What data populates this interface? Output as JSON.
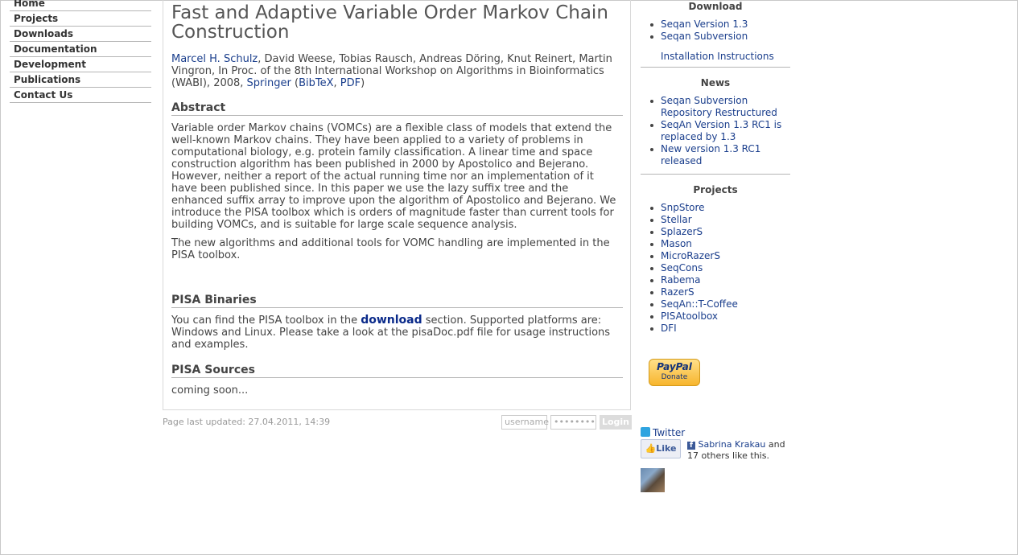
{
  "nav": {
    "items": [
      "Home",
      "Projects",
      "Downloads",
      "Documentation",
      "Development",
      "Publications",
      "Contact Us"
    ]
  },
  "article": {
    "title": "Fast and Adaptive Variable Order Markov Chain Construction",
    "author_link": "Marcel H. Schulz",
    "authors_rest": ", David Weese, Tobias Rausch, Andreas Döring, Knut Reinert, Martin Vingron, In Proc. of the 8th International Workshop on Algorithms in Bioinformatics (WABI), 2008, ",
    "springer_link": "Springer",
    "bibtex_link": "BibTeX",
    "pdf_link": "PDF",
    "abstract_heading": "Abstract",
    "abstract_p1": "Variable order Markov chains (VOMCs) are a flexible class of models that extend the well-known Markov chains. They have been applied to a variety of problems in computational biology, e.g. protein family classification. A linear time and space construction algorithm has been published in 2000 by Apostolico and Bejerano. However, neither a report of the actual running time nor an implementation of it have been published since. In this paper we use the lazy suffix tree and the enhanced suffix array to improve upon the algorithm of Apostolico and Bejerano. We introduce the PISA toolbox which is orders of magnitude faster than current tools for building VOMCs, and is suitable for large scale sequence analysis.",
    "abstract_p2": "The new algorithms and additional tools for VOMC handling are implemented in the PISA toolbox.",
    "binaries_heading": "PISA Binaries",
    "binaries_pre": "You can find the PISA toolbox in the ",
    "binaries_link": "download",
    "binaries_post": " section. Supported platforms are: Windows and Linux. Please take a look at the pisaDoc.pdf file for usage instructions and examples.",
    "sources_heading": "PISA Sources",
    "sources_text": "coming soon..."
  },
  "footer": {
    "last_updated": "Page last updated: 27.04.2011, 14:39",
    "username_placeholder": "username",
    "password_placeholder": "••••••••",
    "login_label": "Login"
  },
  "sidebar": {
    "download_title": "Download",
    "download_items": [
      "Seqan Version 1.3",
      "Seqan Subversion"
    ],
    "install_link": "Installation Instructions",
    "news_title": "News",
    "news_items": [
      "Seqan Subversion Repository Restructured",
      "SeqAn Version 1.3 RC1 is replaced by 1.3",
      "New version 1.3 RC1 released"
    ],
    "projects_title": "Projects",
    "project_items": [
      "SnpStore",
      "Stellar",
      "SplazerS",
      "Mason",
      "MicroRazerS",
      "SeqCons",
      "Rabema",
      "RazerS",
      "SeqAn::T-Coffee",
      "PISAtoolbox",
      "DFI"
    ],
    "paypal_brand": "PayPal",
    "paypal_label": "Donate",
    "twitter_label": "Twitter",
    "like_label": "Like",
    "fb_name": "Sabrina Krakau",
    "fb_rest": " and 17 others like this."
  }
}
